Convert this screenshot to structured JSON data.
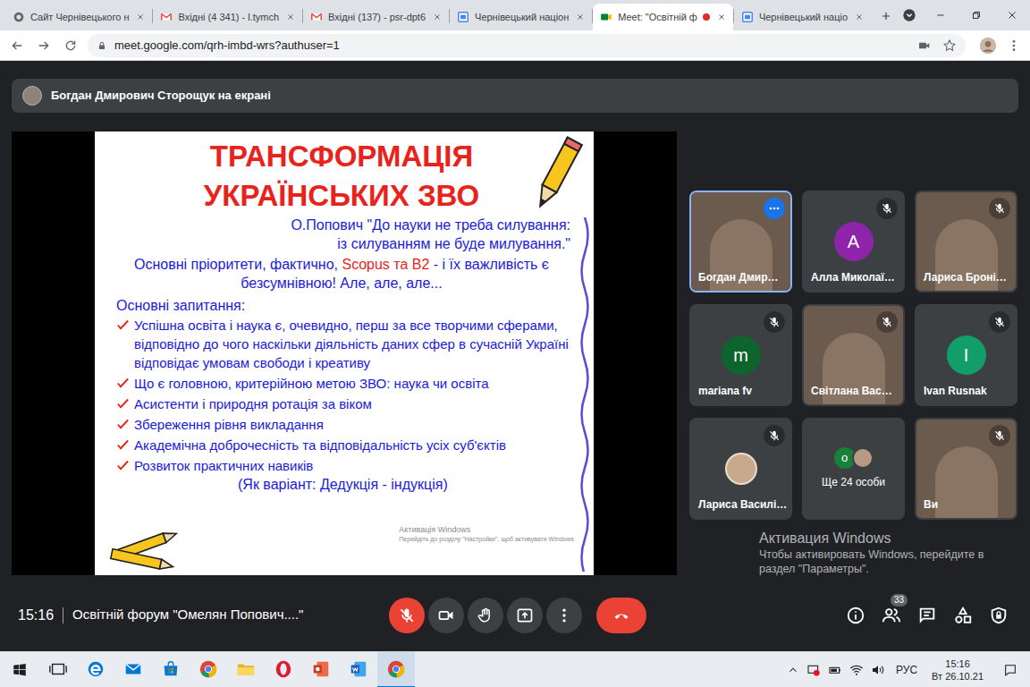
{
  "browser": {
    "tabs": [
      {
        "label": "Сайт Чернівецького н",
        "favicon": "site",
        "selected": false,
        "recording": false
      },
      {
        "label": "Вхідні (4 341) - l.tymch",
        "favicon": "gmail",
        "selected": false,
        "recording": false
      },
      {
        "label": "Вхідні (137) - psr-dpt6",
        "favicon": "gmail",
        "selected": false,
        "recording": false
      },
      {
        "label": "Чернівецький націон",
        "favicon": "calendar",
        "selected": false,
        "recording": false
      },
      {
        "label": "Meet: \"Освітній ф",
        "favicon": "meet",
        "selected": true,
        "recording": true
      },
      {
        "label": "Чернівецький націо",
        "favicon": "calendar",
        "selected": false,
        "recording": false
      }
    ],
    "url": "meet.google.com/qrh-imbd-wrs?authuser=1"
  },
  "meet": {
    "banner": "Богдан Дмирович Сторощук на екрані",
    "slide": {
      "title": [
        "ТРАНСФОРМАЦІЯ",
        "УКРАЇНСЬКИХ ЗВО"
      ],
      "quote": [
        "О.Попович \"До науки не треба силування:",
        "із силуванням не буде милування.\""
      ],
      "priorities": [
        {
          "text": "Основні пріоритети, фактично, ",
          "highlight": false
        },
        {
          "text": "Scopus та B2",
          "highlight": true
        },
        {
          "text": " - і їх важливість є безсумнівною! Але, але, але...",
          "highlight": false
        }
      ],
      "questions_label": "Основні запитання:",
      "questions": [
        "Успішна освіта і наука є, очевидно, перш за все творчими сферами, відповідно до чого наскільки діяльність даних сфер в сучасній Україні відповідає умовам свободи і креативу",
        "Що є головною, критерійною метою ЗВО: наука чи освіта",
        "Асистенти і природня ротація за віком",
        "Збереження рівня викладання",
        "Академічна доброчесність та відповідальність усіх суб'єктів",
        "Розвиток практичних навиків"
      ],
      "note": "(Як варіант: Дедукція - індукція)",
      "watermark": [
        "Активація Windows",
        "Перейдіть до розділу \"Настройки\", щоб активувати Windows"
      ]
    },
    "tiles": [
      {
        "kind": "video",
        "name": "Богдан Дмир…",
        "muted": false,
        "highlighted": true
      },
      {
        "kind": "letter",
        "name": "Алла Миколаї…",
        "letter": "А",
        "color": "#8e24aa",
        "muted": true,
        "highlighted": false
      },
      {
        "kind": "video",
        "name": "Лариса Броні…",
        "muted": true,
        "highlighted": false
      },
      {
        "kind": "letter",
        "name": "mariana fv",
        "letter": "m",
        "color": "#0d652d",
        "muted": true,
        "highlighted": false
      },
      {
        "kind": "video",
        "name": "Світлана Вас…",
        "muted": true,
        "highlighted": false
      },
      {
        "kind": "letter",
        "name": "Ivan Rusnak",
        "letter": "I",
        "color": "#129e6a",
        "muted": true,
        "highlighted": false
      },
      {
        "kind": "photo",
        "name": "Лариса Василі…",
        "muted": true,
        "highlighted": false
      },
      {
        "kind": "more",
        "name": "Ще 24 особи",
        "letter": "о",
        "color": "#188038",
        "muted": false,
        "highlighted": false
      },
      {
        "kind": "video",
        "name": "Ви",
        "muted": true,
        "highlighted": false
      }
    ],
    "time": "15:16",
    "meeting_title": "Освітній форум \"Омелян Попович....\"",
    "mic_muted": true,
    "controls": [
      {
        "kind": "mic"
      },
      {
        "kind": "camera"
      },
      {
        "kind": "hand"
      },
      {
        "kind": "present"
      },
      {
        "kind": "more"
      },
      {
        "kind": "leave"
      }
    ],
    "side_buttons": [
      {
        "kind": "info"
      },
      {
        "kind": "people",
        "badge": "33"
      },
      {
        "kind": "chat"
      },
      {
        "kind": "activities"
      },
      {
        "kind": "safety"
      }
    ]
  },
  "watermark": {
    "title": "Активация Windows",
    "text": "Чтобы активировать Windows, перейдите в раздел \"Параметры\"."
  },
  "taskbar": {
    "apps": [
      {
        "kind": "taskview",
        "selected": false
      },
      {
        "kind": "edge",
        "selected": false
      },
      {
        "kind": "mail",
        "selected": false
      },
      {
        "kind": "store",
        "selected": false
      },
      {
        "kind": "chrome",
        "selected": false
      },
      {
        "kind": "explorer",
        "selected": false
      },
      {
        "kind": "opera",
        "selected": false
      },
      {
        "kind": "powerpoint",
        "selected": false
      },
      {
        "kind": "word",
        "selected": false
      },
      {
        "kind": "chrome",
        "selected": true
      }
    ],
    "lang": "РУС",
    "time": "15:16",
    "date": "Вт 26.10.21"
  }
}
